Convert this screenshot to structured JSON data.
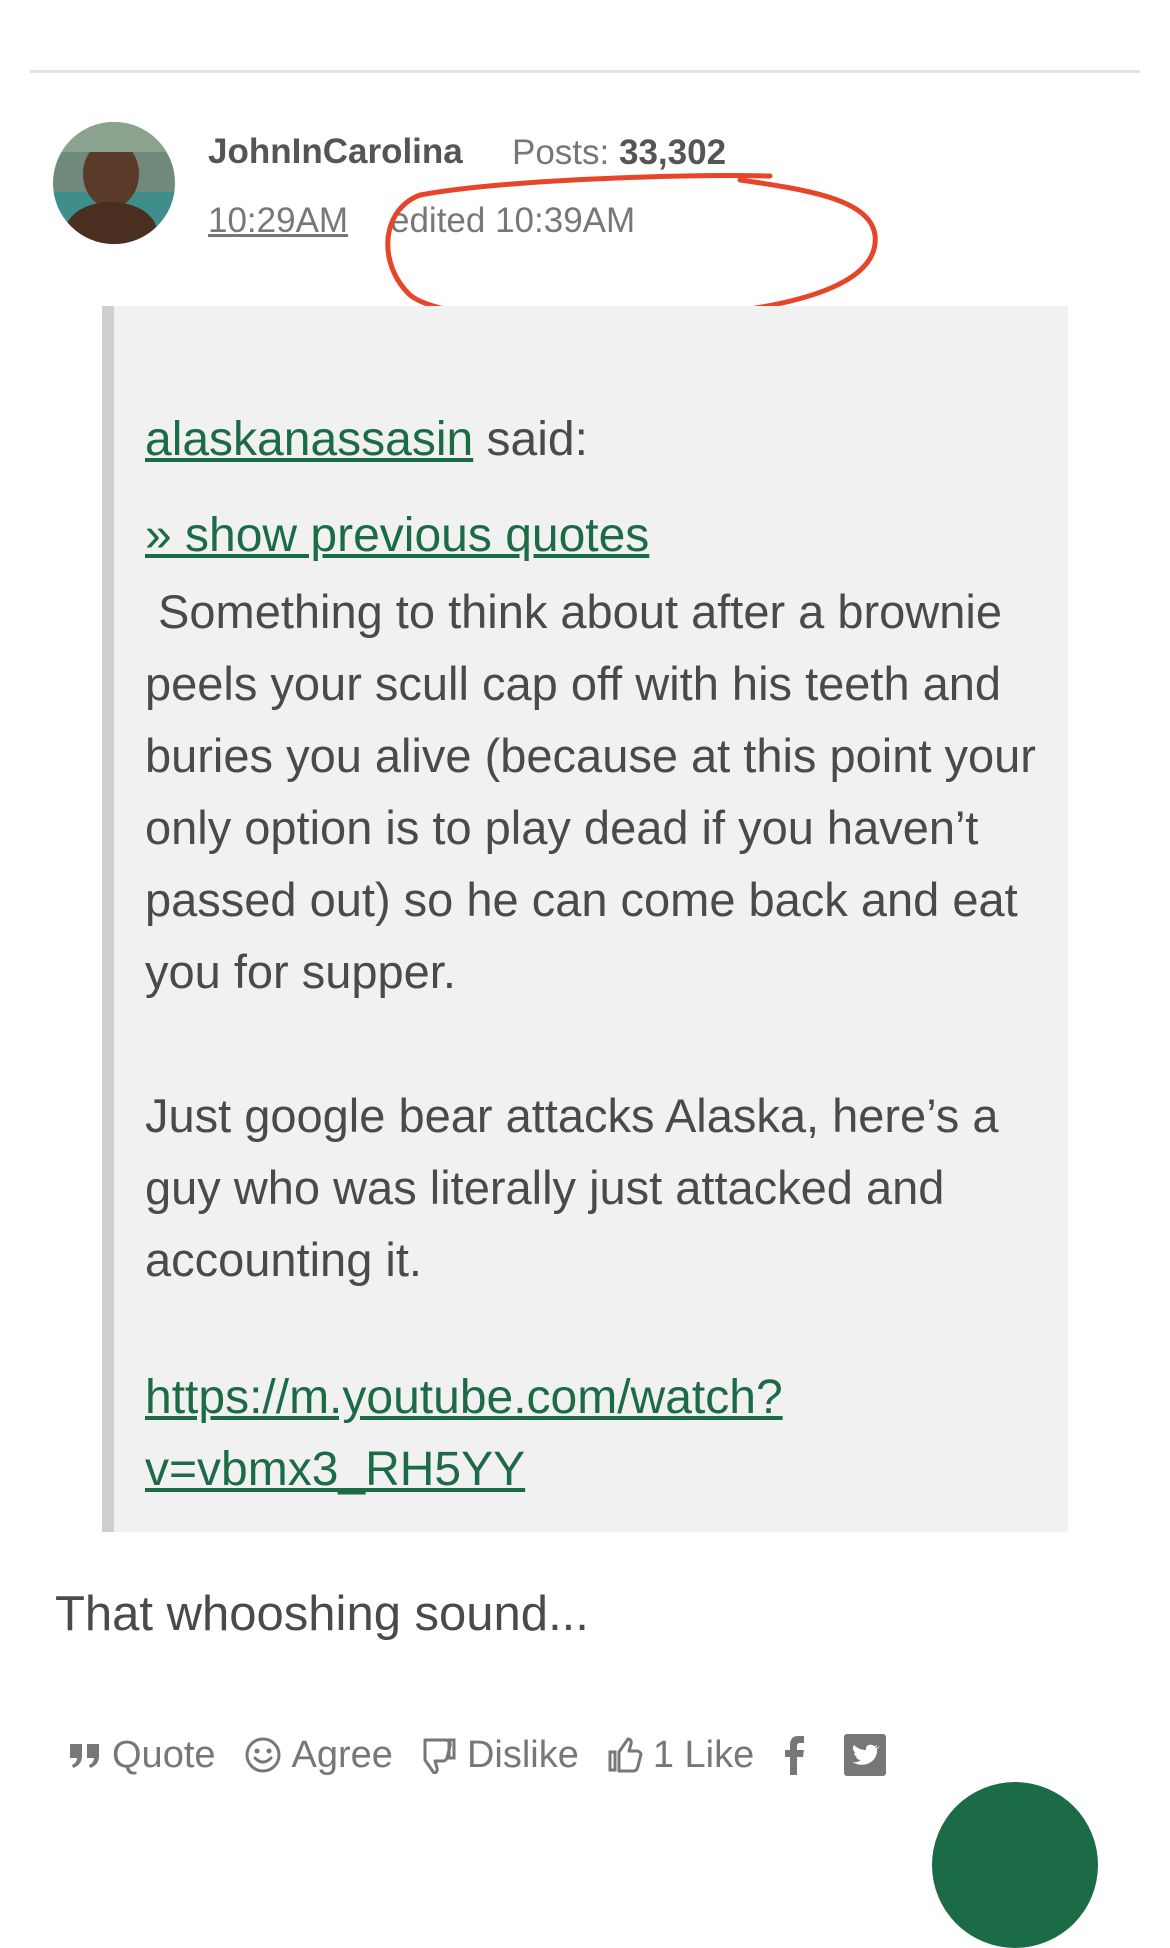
{
  "post": {
    "username": "JohnInCarolina",
    "posts_label": "Posts:",
    "posts_count": "33,302",
    "time": "10:29AM",
    "edited": "edited 10:39AM"
  },
  "quote": {
    "author": "alaskanassasin",
    "said": " said:",
    "show_previous": "» show previous quotes",
    "paragraphs": [
      " Something to think about after a brownie peels your scull cap off with his teeth and buries you alive (because at this point your only option is to play dead if you haven’t passed out) so he can come back and eat you for supper.",
      "Just google bear attacks Alaska, here’s a guy who was literally just attacked and accounting it."
    ],
    "link": "https://m.youtube.com/watch?v=vbmx3_RH5YY"
  },
  "reply": {
    "text": "That whooshing sound..."
  },
  "actions": {
    "quote": "Quote",
    "agree": "Agree",
    "dislike": "Dislike",
    "like": "1 Like"
  },
  "colors": {
    "link_green": "#1b6b46",
    "annotation_red": "#e8442a"
  }
}
